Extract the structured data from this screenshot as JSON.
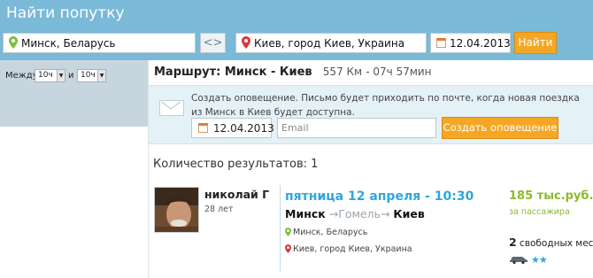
{
  "header": {
    "title": "Найти попутку",
    "from_value": "Минск, Беларусь",
    "swap_label": "<>",
    "to_value": "Киев, город Киев, Украина",
    "date_value": "12.04.2013",
    "find_label": "Найти"
  },
  "sidebar": {
    "between_label": "Между",
    "from_time": "10ч",
    "and_label": "и",
    "to_time": "10ч"
  },
  "route": {
    "label": "Маршрут: Минск - Киев",
    "distance": "557 Км",
    "duration": "07ч 57мин"
  },
  "alert": {
    "text": "Создать оповещение. Письмо будет приходить по почте, когда новая поездка из Минск в Киев будет доступна.",
    "date_value": "12.04.2013",
    "email_placeholder": "Email",
    "button_label": "Создать оповещение"
  },
  "results": {
    "count_label": "Количество результатов: 1",
    "items": [
      {
        "driver_name": "николай Г",
        "driver_age": "28 лет",
        "datetime": "пятница 12 апреля - 10:30",
        "from_city": "Минск",
        "via_city": "Гомель",
        "to_city": "Киев",
        "from_point": "Минск, Беларусь",
        "to_point": "Киев, город Киев, Украина",
        "price": "185 тыс.руб.",
        "price_note": "за пассажира",
        "seats_count": "2",
        "seats_label": "свободных мест",
        "rating_stars": "★★"
      }
    ]
  },
  "colors": {
    "header_bg": "#7ab9d7",
    "accent_orange": "#f5a623",
    "accent_blue": "#2fa6de",
    "price_green": "#8cba2e",
    "sidebar_bg": "#c7d6de",
    "alert_bg": "#e4f1f7"
  }
}
